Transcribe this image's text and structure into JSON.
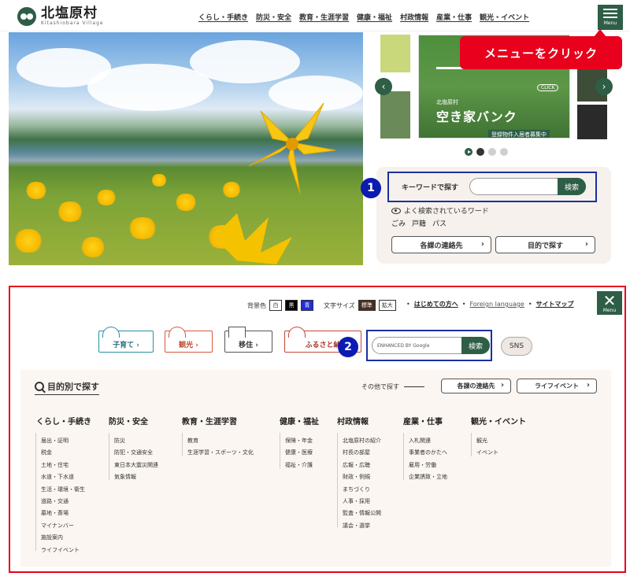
{
  "header": {
    "logo_name": "北塩原村",
    "logo_sub": "Kitashiobara Village",
    "nav": [
      "くらし・手続き",
      "防災・安全",
      "教育・生涯学習",
      "健康・福祉",
      "村政情報",
      "産業・仕事",
      "観光・イベント"
    ],
    "menu_label": "Menu"
  },
  "banner": {
    "sub": "北塩原村",
    "title": "空き家バンク",
    "band": "登録物件入居者募集中",
    "click": "CLICK"
  },
  "annotation": {
    "callout": "メニューをクリック",
    "badge1": "1",
    "badge2": "2"
  },
  "search": {
    "keyword_label": "キーワードで探す",
    "button": "検索",
    "popular_label": "よく検索されているワード",
    "popular_words": [
      "ごみ",
      "戸籍",
      "パス"
    ],
    "contacts_button": "各課の連絡先",
    "purpose_button": "目的で探す"
  },
  "menu_panel": {
    "close_label": "Menu",
    "bgcolor_label": "背景色",
    "bg_options": [
      "白",
      "黒",
      "青"
    ],
    "fontsize_label": "文字サイズ",
    "fontsize_options": [
      "標準",
      "拡大"
    ],
    "links": [
      "はじめての方へ",
      "Foreign language",
      "サイトマップ"
    ],
    "tags": [
      "子育て",
      "観光",
      "移住",
      "ふるさと納"
    ],
    "google_label": "ENHANCED BY Google",
    "google_button": "検索",
    "sns": "SNS",
    "purpose_title": "目的別で探す",
    "other_label": "その他で探す",
    "contacts_button": "各課の連絡先",
    "lifeevent_button": "ライフイベント",
    "columns": [
      {
        "head": "くらし・手続き",
        "items": [
          "届出・証明",
          "税金",
          "土地・住宅",
          "水道・下水道",
          "生活・環境・衛生",
          "道路・交通",
          "墓地・斎場",
          "マイナンバー",
          "施設案内",
          "ライフイベント"
        ]
      },
      {
        "head": "防災・安全",
        "items": [
          "防災",
          "防犯・交通安全",
          "東日本大震災関連",
          "気象情報"
        ]
      },
      {
        "head": "教育・生涯学習",
        "items": [
          "教育",
          "生涯学習・スポーツ・文化"
        ]
      },
      {
        "head": "健康・福祉",
        "items": [
          "保険・年金",
          "健康・医療",
          "福祉・介護"
        ]
      },
      {
        "head": "村政情報",
        "items": [
          "北塩原村の紹介",
          "村長の部屋",
          "広報・広聴",
          "財政・例規",
          "まちづくり",
          "人事・採用",
          "監査・情報公開",
          "議会・選挙"
        ]
      },
      {
        "head": "産業・仕事",
        "items": [
          "入札関連",
          "事業者のかたへ",
          "雇用・労働",
          "企業誘致・立地"
        ]
      },
      {
        "head": "観光・イベント",
        "items": [
          "観光",
          "イベント"
        ]
      }
    ]
  },
  "colors": {
    "brand": "#2e5e46",
    "annotation_red": "#e8001c",
    "annotation_blue": "#1c2fa0"
  }
}
